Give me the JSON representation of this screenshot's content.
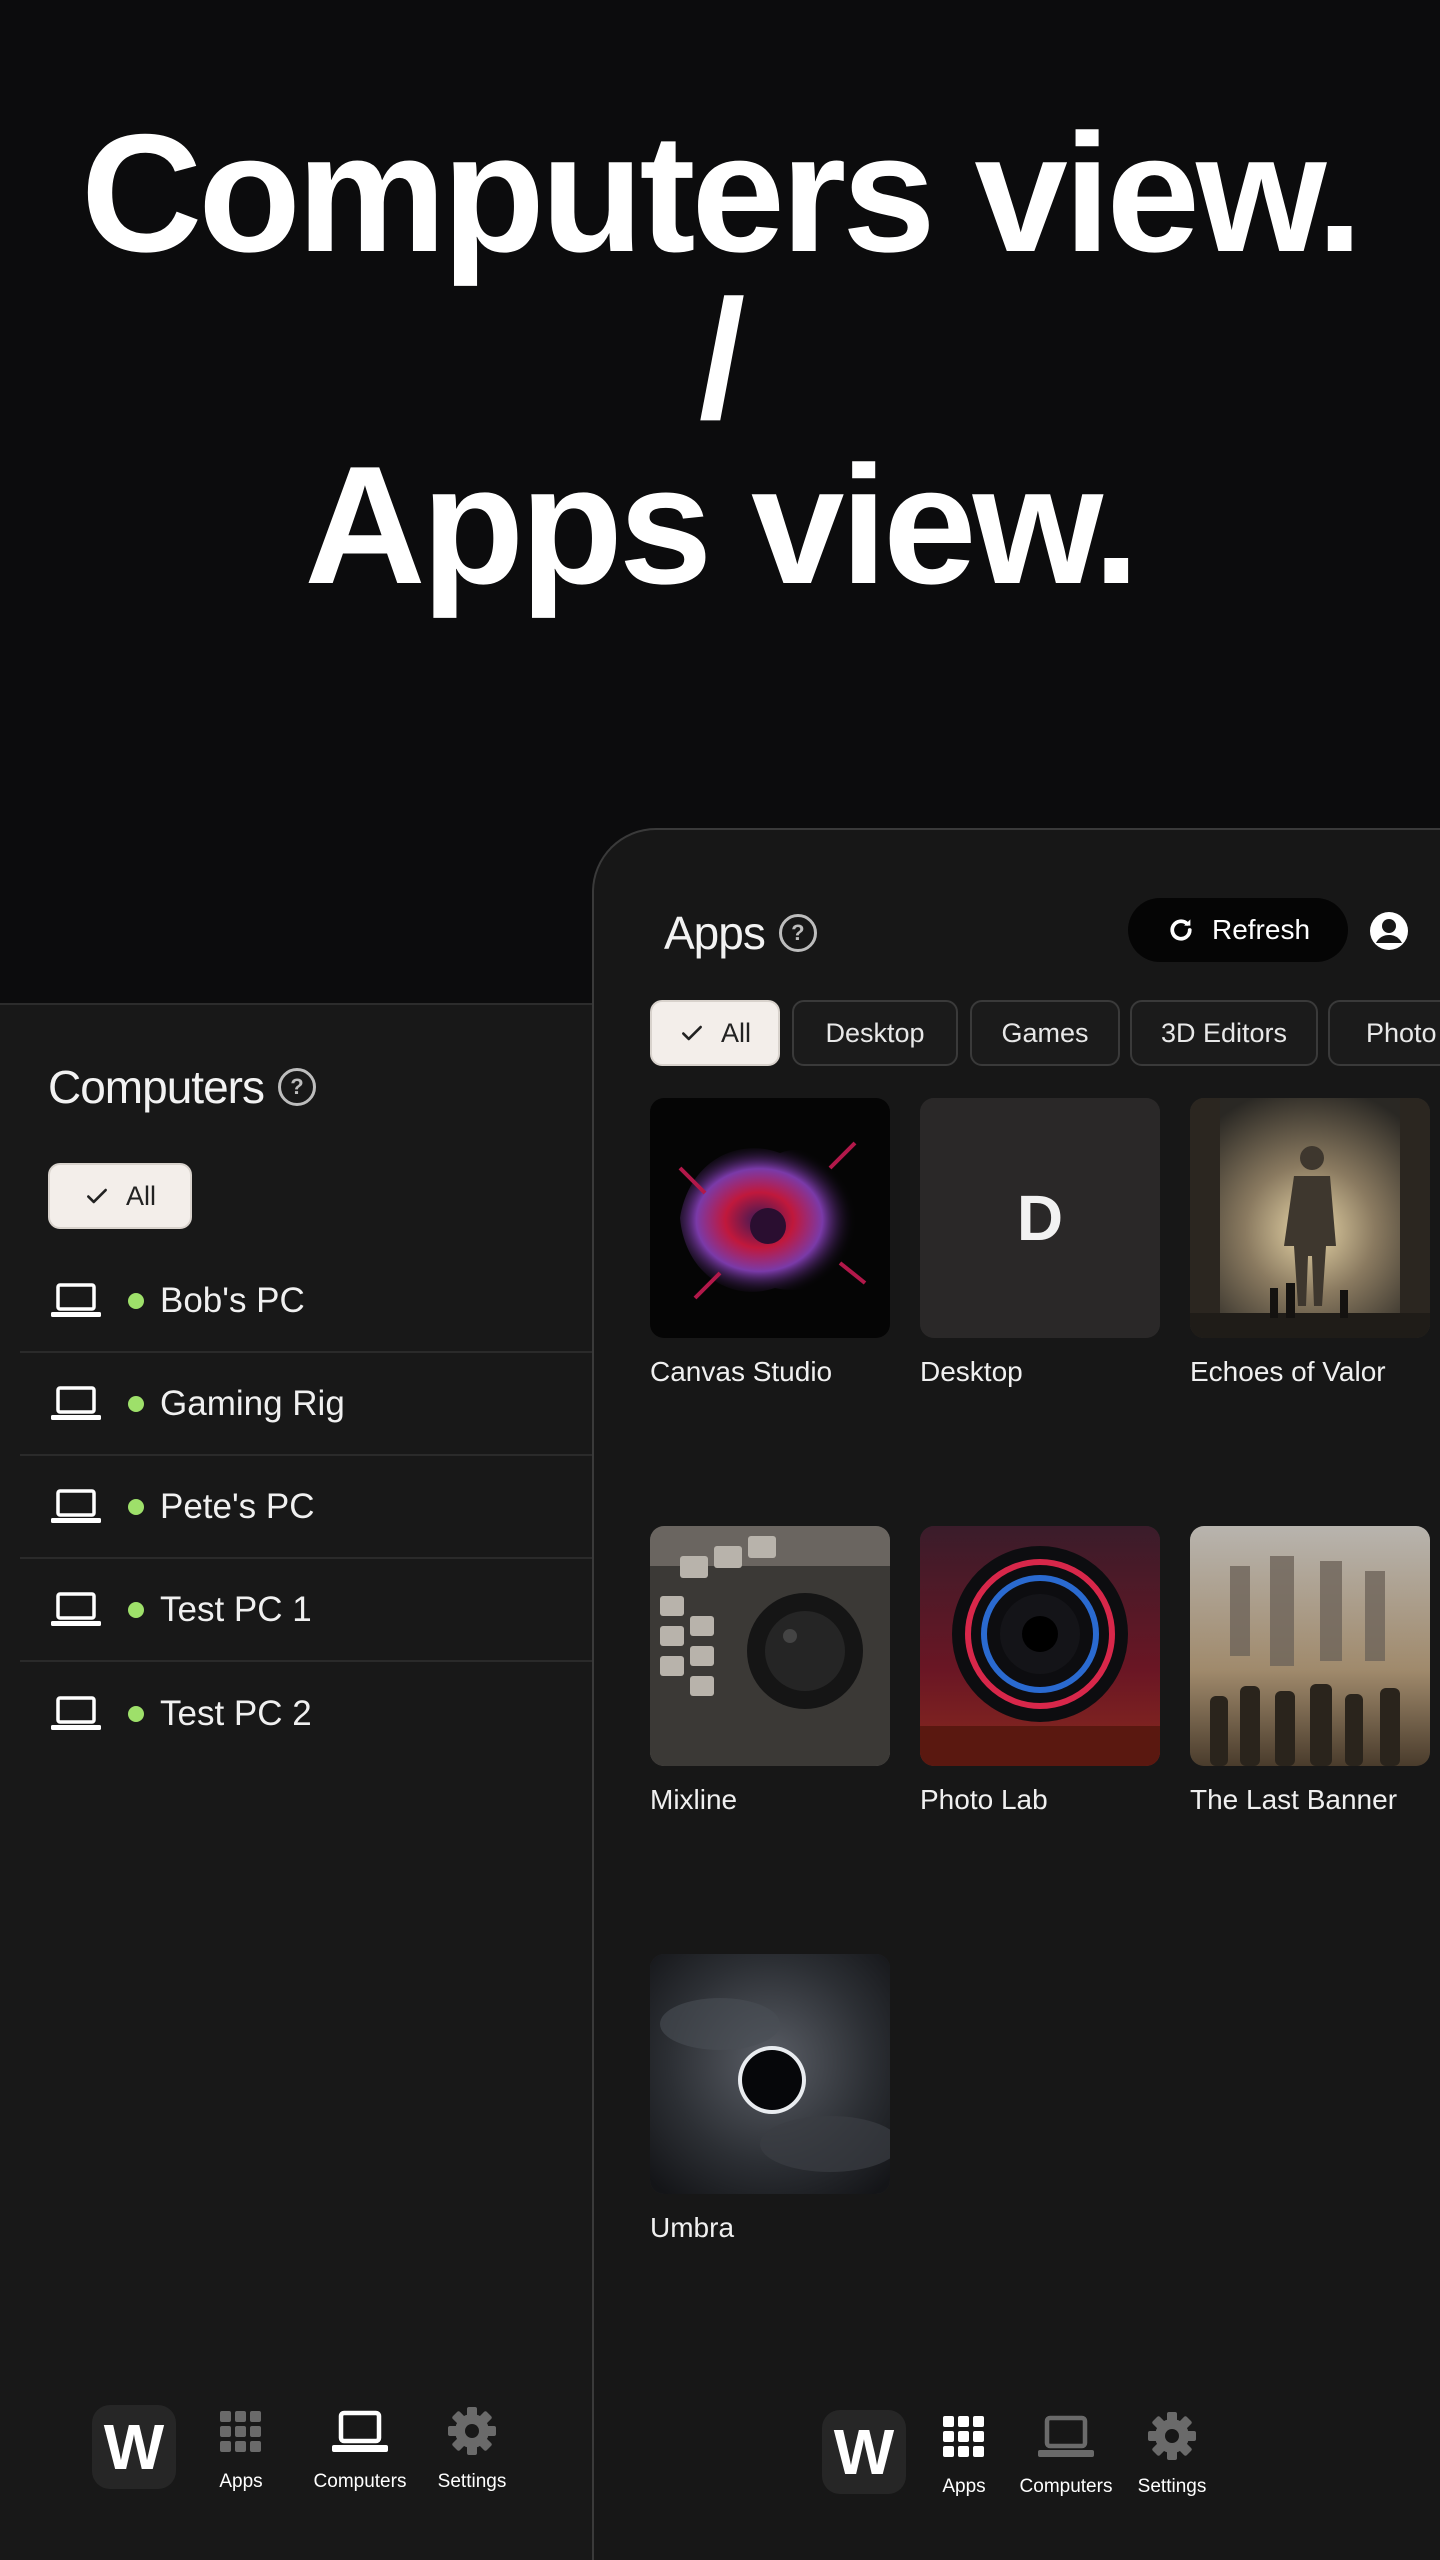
{
  "headline": {
    "line1": "Computers view.",
    "line2": "/",
    "line3": "Apps view."
  },
  "computers_panel": {
    "title": "Computers",
    "help_glyph": "?",
    "filter_chip": "All",
    "computers": [
      {
        "name": "Bob's PC",
        "status": "online",
        "status_color": "#9ee06a"
      },
      {
        "name": "Gaming Rig",
        "status": "online",
        "status_color": "#9ee06a"
      },
      {
        "name": "Pete's PC",
        "status": "online",
        "status_color": "#9ee06a"
      },
      {
        "name": "Test PC 1",
        "status": "online",
        "status_color": "#9ee06a"
      },
      {
        "name": "Test PC 2",
        "status": "online",
        "status_color": "#9ee06a"
      }
    ],
    "nav": {
      "logo": "W",
      "apps": "Apps",
      "computers": "Computers",
      "settings": "Settings",
      "active": "computers"
    }
  },
  "apps_panel": {
    "title": "Apps",
    "help_glyph": "?",
    "refresh_label": "Refresh",
    "filters": [
      "All",
      "Desktop",
      "Games",
      "3D Editors",
      "Photo E"
    ],
    "active_filter": "All",
    "apps": [
      {
        "name": "Canvas Studio",
        "thumb": "abstract-red-purple-ink-image"
      },
      {
        "name": "Desktop",
        "thumb": "letter-tile",
        "letter": "D"
      },
      {
        "name": "Echoes of Valor",
        "thumb": "giant-figure-city-image"
      },
      {
        "name": "Mixline",
        "thumb": "keyboard-jog-wheel-image"
      },
      {
        "name": "Photo Lab",
        "thumb": "camera-lens-image"
      },
      {
        "name": "The Last Banner",
        "thumb": "army-of-figures-image"
      },
      {
        "name": "Umbra",
        "thumb": "eclipse-clouds-image"
      }
    ],
    "nav": {
      "logo": "W",
      "apps": "Apps",
      "computers": "Computers",
      "settings": "Settings",
      "active": "apps"
    }
  },
  "colors": {
    "background": "#0c0c0d",
    "panel": "#181818",
    "online": "#9ee06a",
    "active_chip": "#f3eeea"
  }
}
